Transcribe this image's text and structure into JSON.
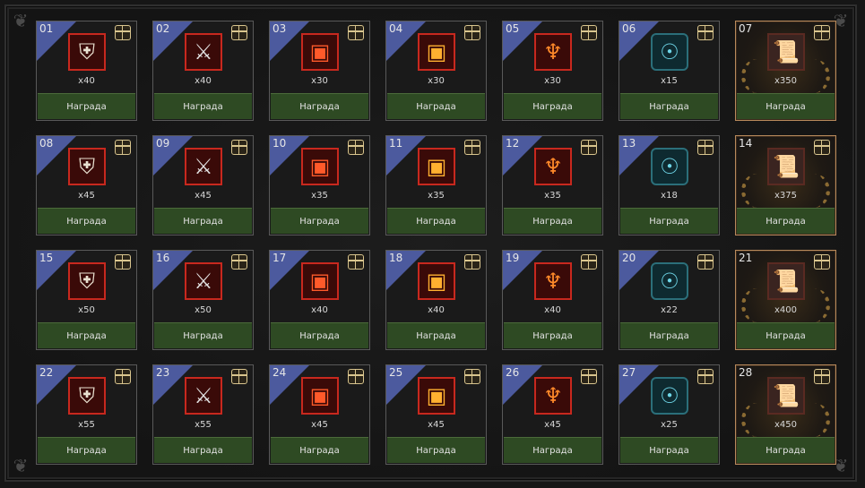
{
  "reward_label": "Награда",
  "rewards": [
    {
      "num": "01",
      "qty": "x40",
      "icon": "armor-icon",
      "special": false
    },
    {
      "num": "02",
      "qty": "x40",
      "icon": "blade-icon",
      "special": false
    },
    {
      "num": "03",
      "qty": "x30",
      "icon": "red-chest-icon",
      "special": false
    },
    {
      "num": "04",
      "qty": "x30",
      "icon": "gold-chest-icon",
      "special": false
    },
    {
      "num": "05",
      "qty": "x30",
      "icon": "wings-chest-icon",
      "special": false
    },
    {
      "num": "06",
      "qty": "x15",
      "icon": "elixir-icon",
      "special": false
    },
    {
      "num": "07",
      "qty": "x350",
      "icon": "scroll-icon",
      "special": true
    },
    {
      "num": "08",
      "qty": "x45",
      "icon": "armor-icon",
      "special": false
    },
    {
      "num": "09",
      "qty": "x45",
      "icon": "blade-icon",
      "special": false
    },
    {
      "num": "10",
      "qty": "x35",
      "icon": "red-chest-icon",
      "special": false
    },
    {
      "num": "11",
      "qty": "x35",
      "icon": "gold-chest-icon",
      "special": false
    },
    {
      "num": "12",
      "qty": "x35",
      "icon": "wings-chest-icon",
      "special": false
    },
    {
      "num": "13",
      "qty": "x18",
      "icon": "elixir-icon",
      "special": false
    },
    {
      "num": "14",
      "qty": "x375",
      "icon": "scroll-icon",
      "special": true
    },
    {
      "num": "15",
      "qty": "x50",
      "icon": "armor-icon",
      "special": false
    },
    {
      "num": "16",
      "qty": "x50",
      "icon": "blade-icon",
      "special": false
    },
    {
      "num": "17",
      "qty": "x40",
      "icon": "red-chest-icon",
      "special": false
    },
    {
      "num": "18",
      "qty": "x40",
      "icon": "gold-chest-icon",
      "special": false
    },
    {
      "num": "19",
      "qty": "x40",
      "icon": "wings-chest-icon",
      "special": false
    },
    {
      "num": "20",
      "qty": "x22",
      "icon": "elixir-icon",
      "special": false
    },
    {
      "num": "21",
      "qty": "x400",
      "icon": "scroll-icon",
      "special": true
    },
    {
      "num": "22",
      "qty": "x55",
      "icon": "armor-icon",
      "special": false
    },
    {
      "num": "23",
      "qty": "x55",
      "icon": "blade-icon",
      "special": false
    },
    {
      "num": "24",
      "qty": "x45",
      "icon": "red-chest-icon",
      "special": false
    },
    {
      "num": "25",
      "qty": "x45",
      "icon": "gold-chest-icon",
      "special": false
    },
    {
      "num": "26",
      "qty": "x45",
      "icon": "wings-chest-icon",
      "special": false
    },
    {
      "num": "27",
      "qty": "x25",
      "icon": "elixir-icon",
      "special": false
    },
    {
      "num": "28",
      "qty": "x450",
      "icon": "scroll-icon",
      "special": true
    }
  ]
}
